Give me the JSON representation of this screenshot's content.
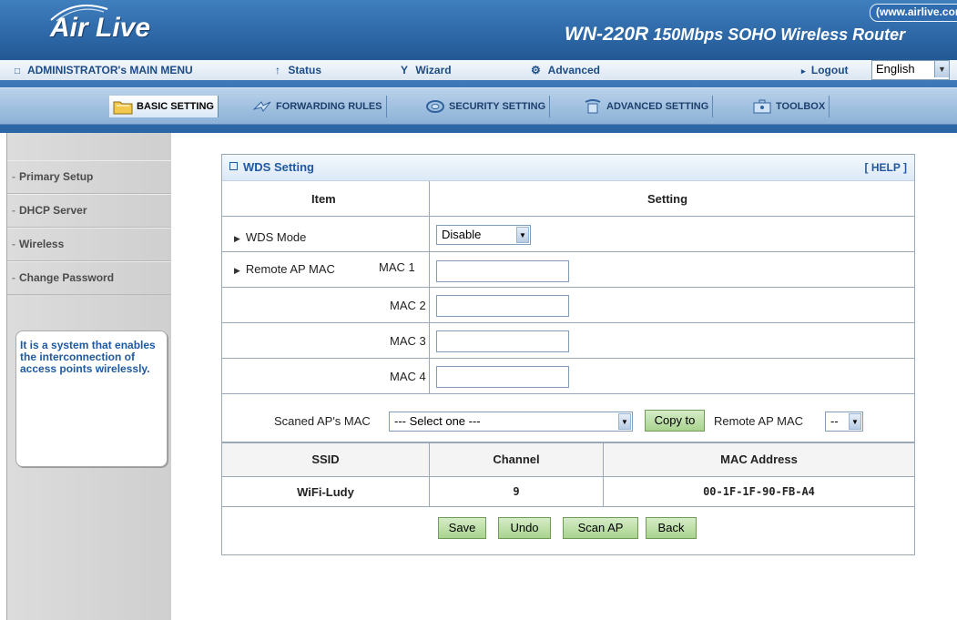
{
  "header": {
    "logo_text": "Air Live",
    "site_url": "(www.airlive.com)",
    "model_name": "WN-220R",
    "model_desc": "150Mbps SOHO Wireless Router"
  },
  "menu": {
    "main_menu_label": "ADMINISTRATOR's MAIN MENU",
    "status_label": "Status",
    "wizard_label": "Wizard",
    "advanced_label": "Advanced",
    "logout_label": "Logout",
    "language_value": "English"
  },
  "tabs": [
    {
      "label": "BASIC SETTING",
      "active": true
    },
    {
      "label": "FORWARDING RULES"
    },
    {
      "label": "SECURITY SETTING"
    },
    {
      "label": "ADVANCED SETTING"
    },
    {
      "label": "TOOLBOX"
    }
  ],
  "sidebar": {
    "items": [
      {
        "label": "Primary Setup"
      },
      {
        "label": "DHCP Server"
      },
      {
        "label": "Wireless"
      },
      {
        "label": "Change Password"
      }
    ],
    "info_text": "It is a system that enables the interconnection of access points wirelessly."
  },
  "panel": {
    "title": "WDS Setting",
    "help_label": "[ HELP ]",
    "col_item": "Item",
    "col_setting": "Setting",
    "wds_mode_label": "WDS Mode",
    "wds_mode_value": "Disable",
    "remote_ap_mac_label": "Remote AP MAC",
    "mac_labels": [
      "MAC 1",
      "MAC 2",
      "MAC 3",
      "MAC 4"
    ],
    "mac_values": [
      "",
      "",
      "",
      ""
    ],
    "scanned_label": "Scaned AP's MAC",
    "scanned_select_value": "--- Select one ---",
    "copy_to_label": "Copy to",
    "remote_ap_mac_label2": "Remote AP MAC",
    "remote_ap_select_value": "--"
  },
  "scan_table": {
    "headers": [
      "SSID",
      "Channel",
      "MAC Address"
    ],
    "rows": [
      {
        "ssid": "WiFi-Ludy",
        "channel": "9",
        "mac": "00-1F-1F-90-FB-A4"
      }
    ]
  },
  "buttons": {
    "save": "Save",
    "undo": "Undo",
    "scan_ap": "Scan AP",
    "back": "Back"
  },
  "colors": {
    "header_blue": "#2d67a6",
    "link_blue": "#1d5aa3",
    "button_green": "#a9d38f"
  }
}
